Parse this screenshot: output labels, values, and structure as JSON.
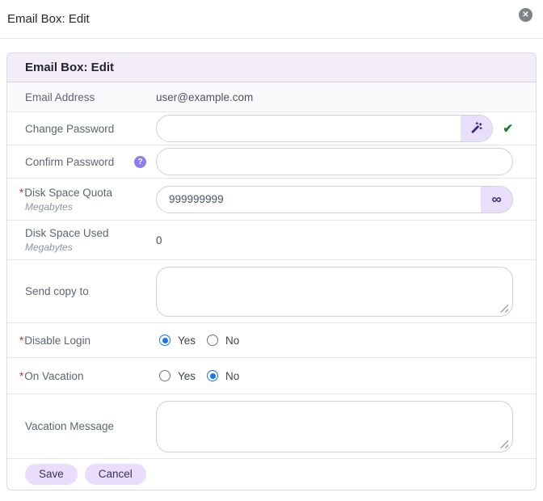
{
  "window": {
    "title": "Email Box: Edit",
    "close_icon": "✕"
  },
  "panel": {
    "title": "Email Box: Edit"
  },
  "required_marker": "*",
  "rows": [
    {
      "label": "Email Address",
      "value": "user@example.com"
    },
    {
      "label": "Change Password",
      "value": "",
      "wand_icon": "magic-wand",
      "check_icon": "✔"
    },
    {
      "label": "Confirm Password",
      "value": "",
      "help_icon": "?"
    },
    {
      "label": "Disk Space Quota",
      "required": "*",
      "unit": "Megabytes",
      "value": "999999999",
      "infinity_icon": "∞"
    },
    {
      "label": "Disk Space Used",
      "unit": "Megabytes",
      "value": "0"
    },
    {
      "label": "Send copy to",
      "value": ""
    },
    {
      "label": "Disable Login",
      "required": "*",
      "yes_label": "Yes",
      "no_label": "No",
      "selected": "Yes"
    },
    {
      "label": "On Vacation",
      "required": "*",
      "yes_label": "Yes",
      "no_label": "No",
      "selected": "No"
    },
    {
      "label": "Vacation Message",
      "value": ""
    }
  ],
  "footer": {
    "save_label": "Save",
    "cancel_label": "Cancel"
  },
  "colors": {
    "header_bg": "#f3edf7",
    "accent_button_bg": "#eadffb",
    "accent_icon": "#3a2a7d",
    "help_badge_bg": "#8f7df0",
    "check_green": "#1d7a33",
    "radio_blue": "#1a73e8",
    "required_red": "#cc2b2b"
  }
}
